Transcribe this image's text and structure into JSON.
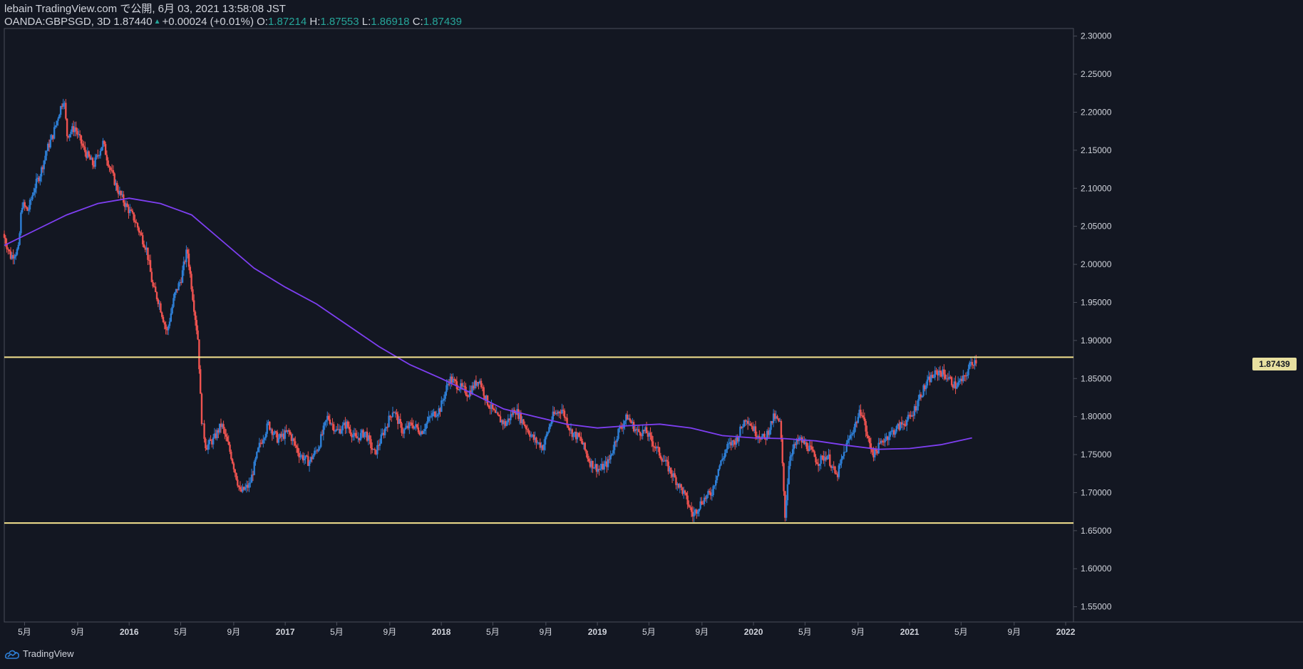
{
  "header": {
    "line1": "lebain TradingView.com で公開, 6月 03, 2021 13:58:08 JST",
    "symbol": "OANDA:GBPSGD, 3D",
    "price": "1.87440",
    "change": "+0.00024 (+0.01%)",
    "o_label": "O:",
    "o_value": "1.87214",
    "h_label": "H:",
    "h_value": "1.87553",
    "l_label": "L:",
    "l_value": "1.86918",
    "c_label": "C:",
    "c_value": "1.87439"
  },
  "footer": {
    "brand": "TradingView"
  },
  "colors": {
    "background": "#131722",
    "up": "#2e7fd6",
    "down": "#ef5350",
    "ma": "#7e3ff2",
    "hline": "#f4e38f",
    "axis_text": "#d1d4dc",
    "grid_border": "#4a4e5a"
  },
  "chart_data": {
    "type": "candlestick",
    "symbol": "OANDA:GBPSGD",
    "interval": "3D",
    "ylim": [
      1.53,
      2.31
    ],
    "y_ticks": [
      "2.30000",
      "2.25000",
      "2.20000",
      "2.15000",
      "2.10000",
      "2.05000",
      "2.00000",
      "1.95000",
      "1.90000",
      "1.85000",
      "1.80000",
      "1.75000",
      "1.70000",
      "1.65000",
      "1.60000",
      "1.55000"
    ],
    "x_ticks": [
      {
        "label": "5月",
        "t": 2015.33
      },
      {
        "label": "9月",
        "t": 2015.67
      },
      {
        "label": "2016",
        "t": 2016.0
      },
      {
        "label": "5月",
        "t": 2016.33
      },
      {
        "label": "9月",
        "t": 2016.67
      },
      {
        "label": "2017",
        "t": 2017.0
      },
      {
        "label": "5月",
        "t": 2017.33
      },
      {
        "label": "9月",
        "t": 2017.67
      },
      {
        "label": "2018",
        "t": 2018.0
      },
      {
        "label": "5月",
        "t": 2018.33
      },
      {
        "label": "9月",
        "t": 2018.67
      },
      {
        "label": "2019",
        "t": 2019.0
      },
      {
        "label": "5月",
        "t": 2019.33
      },
      {
        "label": "9月",
        "t": 2019.67
      },
      {
        "label": "2020",
        "t": 2020.0
      },
      {
        "label": "5月",
        "t": 2020.33
      },
      {
        "label": "9月",
        "t": 2020.67
      },
      {
        "label": "2021",
        "t": 2021.0
      },
      {
        "label": "5月",
        "t": 2021.33
      },
      {
        "label": "9月",
        "t": 2021.67
      },
      {
        "label": "2022",
        "t": 2022.0
      }
    ],
    "xlim": [
      2015.2,
      2022.05
    ],
    "horizontal_lines": [
      1.878,
      1.66
    ],
    "last_price_label": "1.87439",
    "last_price": 1.87439,
    "price_path": [
      [
        2015.2,
        2.04
      ],
      [
        2015.25,
        2.01
      ],
      [
        2015.3,
        2.02
      ],
      [
        2015.32,
        2.08
      ],
      [
        2015.36,
        2.07
      ],
      [
        2015.4,
        2.1
      ],
      [
        2015.44,
        2.12
      ],
      [
        2015.48,
        2.15
      ],
      [
        2015.52,
        2.17
      ],
      [
        2015.56,
        2.2
      ],
      [
        2015.59,
        2.22
      ],
      [
        2015.61,
        2.17
      ],
      [
        2015.66,
        2.18
      ],
      [
        2015.72,
        2.15
      ],
      [
        2015.78,
        2.13
      ],
      [
        2015.84,
        2.16
      ],
      [
        2015.88,
        2.13
      ],
      [
        2015.93,
        2.1
      ],
      [
        2015.98,
        2.08
      ],
      [
        2016.04,
        2.06
      ],
      [
        2016.08,
        2.04
      ],
      [
        2016.12,
        2.02
      ],
      [
        2016.16,
        1.97
      ],
      [
        2016.2,
        1.95
      ],
      [
        2016.25,
        1.91
      ],
      [
        2016.3,
        1.96
      ],
      [
        2016.34,
        1.98
      ],
      [
        2016.38,
        2.02
      ],
      [
        2016.42,
        1.95
      ],
      [
        2016.45,
        1.9
      ],
      [
        2016.47,
        1.8
      ],
      [
        2016.5,
        1.76
      ],
      [
        2016.55,
        1.77
      ],
      [
        2016.6,
        1.79
      ],
      [
        2016.66,
        1.75
      ],
      [
        2016.72,
        1.7
      ],
      [
        2016.78,
        1.71
      ],
      [
        2016.84,
        1.76
      ],
      [
        2016.9,
        1.79
      ],
      [
        2016.96,
        1.77
      ],
      [
        2017.03,
        1.78
      ],
      [
        2017.1,
        1.75
      ],
      [
        2017.16,
        1.74
      ],
      [
        2017.22,
        1.76
      ],
      [
        2017.28,
        1.8
      ],
      [
        2017.34,
        1.78
      ],
      [
        2017.4,
        1.79
      ],
      [
        2017.46,
        1.77
      ],
      [
        2017.52,
        1.78
      ],
      [
        2017.58,
        1.75
      ],
      [
        2017.64,
        1.78
      ],
      [
        2017.7,
        1.81
      ],
      [
        2017.76,
        1.78
      ],
      [
        2017.82,
        1.79
      ],
      [
        2017.88,
        1.78
      ],
      [
        2017.94,
        1.8
      ],
      [
        2018.0,
        1.81
      ],
      [
        2018.06,
        1.85
      ],
      [
        2018.12,
        1.84
      ],
      [
        2018.18,
        1.83
      ],
      [
        2018.25,
        1.85
      ],
      [
        2018.3,
        1.82
      ],
      [
        2018.36,
        1.8
      ],
      [
        2018.42,
        1.79
      ],
      [
        2018.48,
        1.81
      ],
      [
        2018.54,
        1.79
      ],
      [
        2018.6,
        1.77
      ],
      [
        2018.66,
        1.76
      ],
      [
        2018.72,
        1.8
      ],
      [
        2018.78,
        1.81
      ],
      [
        2018.84,
        1.78
      ],
      [
        2018.9,
        1.77
      ],
      [
        2018.96,
        1.74
      ],
      [
        2019.02,
        1.73
      ],
      [
        2019.08,
        1.74
      ],
      [
        2019.14,
        1.78
      ],
      [
        2019.2,
        1.8
      ],
      [
        2019.26,
        1.78
      ],
      [
        2019.32,
        1.78
      ],
      [
        2019.38,
        1.76
      ],
      [
        2019.44,
        1.74
      ],
      [
        2019.5,
        1.72
      ],
      [
        2019.56,
        1.7
      ],
      [
        2019.62,
        1.67
      ],
      [
        2019.68,
        1.69
      ],
      [
        2019.74,
        1.7
      ],
      [
        2019.78,
        1.73
      ],
      [
        2019.84,
        1.76
      ],
      [
        2019.9,
        1.77
      ],
      [
        2019.96,
        1.8
      ],
      [
        2020.02,
        1.78
      ],
      [
        2020.08,
        1.77
      ],
      [
        2020.14,
        1.8
      ],
      [
        2020.18,
        1.79
      ],
      [
        2020.21,
        1.67
      ],
      [
        2020.24,
        1.75
      ],
      [
        2020.3,
        1.77
      ],
      [
        2020.36,
        1.76
      ],
      [
        2020.42,
        1.74
      ],
      [
        2020.48,
        1.75
      ],
      [
        2020.54,
        1.72
      ],
      [
        2020.6,
        1.76
      ],
      [
        2020.66,
        1.79
      ],
      [
        2020.7,
        1.81
      ],
      [
        2020.74,
        1.77
      ],
      [
        2020.78,
        1.75
      ],
      [
        2020.84,
        1.77
      ],
      [
        2020.9,
        1.78
      ],
      [
        2020.96,
        1.79
      ],
      [
        2021.02,
        1.8
      ],
      [
        2021.08,
        1.83
      ],
      [
        2021.14,
        1.85
      ],
      [
        2021.2,
        1.86
      ],
      [
        2021.26,
        1.85
      ],
      [
        2021.3,
        1.84
      ],
      [
        2021.36,
        1.85
      ],
      [
        2021.4,
        1.87
      ],
      [
        2021.43,
        1.874
      ]
    ],
    "moving_average": [
      [
        2015.2,
        2.025
      ],
      [
        2015.4,
        2.045
      ],
      [
        2015.6,
        2.065
      ],
      [
        2015.8,
        2.08
      ],
      [
        2016.0,
        2.087
      ],
      [
        2016.2,
        2.08
      ],
      [
        2016.4,
        2.065
      ],
      [
        2016.6,
        2.03
      ],
      [
        2016.8,
        1.995
      ],
      [
        2017.0,
        1.97
      ],
      [
        2017.2,
        1.948
      ],
      [
        2017.4,
        1.92
      ],
      [
        2017.6,
        1.892
      ],
      [
        2017.8,
        1.868
      ],
      [
        2018.0,
        1.85
      ],
      [
        2018.2,
        1.83
      ],
      [
        2018.4,
        1.81
      ],
      [
        2018.6,
        1.8
      ],
      [
        2018.8,
        1.79
      ],
      [
        2019.0,
        1.785
      ],
      [
        2019.2,
        1.788
      ],
      [
        2019.4,
        1.79
      ],
      [
        2019.6,
        1.785
      ],
      [
        2019.8,
        1.775
      ],
      [
        2020.0,
        1.772
      ],
      [
        2020.2,
        1.771
      ],
      [
        2020.4,
        1.768
      ],
      [
        2020.6,
        1.762
      ],
      [
        2020.8,
        1.757
      ],
      [
        2021.0,
        1.758
      ],
      [
        2021.2,
        1.763
      ],
      [
        2021.4,
        1.772
      ]
    ],
    "series": [
      {
        "name": "GBPSGD",
        "kind": "candles"
      },
      {
        "name": "MA",
        "kind": "line"
      }
    ]
  }
}
